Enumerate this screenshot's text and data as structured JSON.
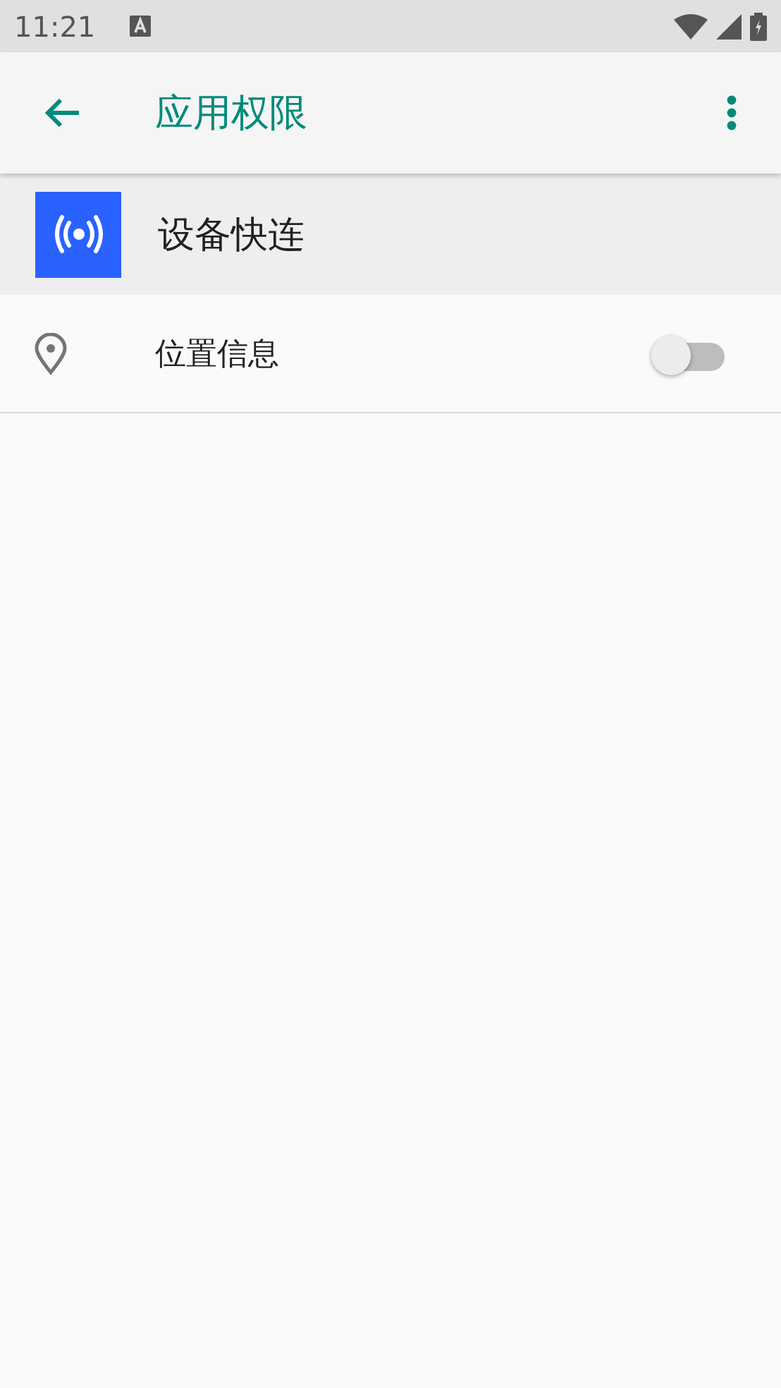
{
  "status_bar": {
    "time": "11:21"
  },
  "app_bar": {
    "title": "应用权限"
  },
  "app_header": {
    "name": "设备快连"
  },
  "permissions": [
    {
      "label": "位置信息",
      "on": false
    }
  ]
}
